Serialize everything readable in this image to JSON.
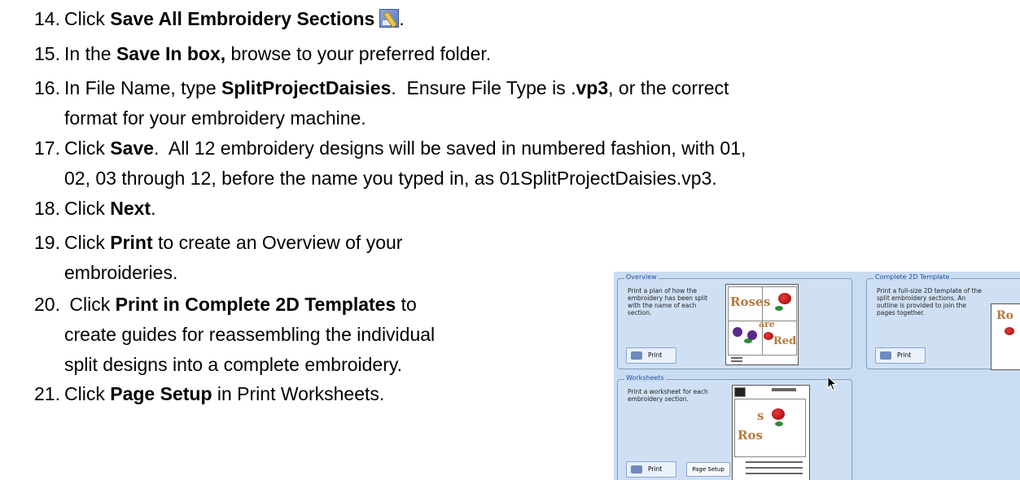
{
  "steps": [
    {
      "num": "14.",
      "parts": [
        {
          "t": "Click "
        },
        {
          "b": "Save All Embroidery Sections"
        }
      ],
      "icon": "save-all-icon",
      "after_icon": "."
    },
    {
      "num": "15.",
      "parts": [
        {
          "t": "In the "
        },
        {
          "b": "Save In box,"
        },
        {
          "t": " browse to your preferred folder."
        }
      ]
    },
    {
      "num": "16.",
      "parts": [
        {
          "t": "In File Name, type "
        },
        {
          "b": "SplitProjectDaisies"
        },
        {
          "t": ".  Ensure File Type is ."
        },
        {
          "b": "vp3"
        },
        {
          "t": ", or the correct"
        }
      ],
      "line2": "format for your embroidery machine."
    },
    {
      "num": "17.",
      "parts": [
        {
          "t": "Click "
        },
        {
          "b": "Save"
        },
        {
          "t": ".  All 12 embroidery designs will be saved in numbered fashion, with 01,"
        }
      ],
      "line2": "02, 03 through 12, before the name you typed in, as 01SplitProjectDaisies.vp3."
    },
    {
      "num": "18.",
      "parts": [
        {
          "t": "Click "
        },
        {
          "b": "Next"
        },
        {
          "t": "."
        }
      ]
    },
    {
      "num": "19.",
      "parts": [
        {
          "t": "Click "
        },
        {
          "b": "Print"
        },
        {
          "t": " to create an Overview of your"
        }
      ],
      "line2": "embroideries."
    },
    {
      "num": "20.",
      "parts": [
        {
          "t": " Click "
        },
        {
          "b": "Print in Complete 2D Templates"
        },
        {
          "t": " to"
        }
      ],
      "line2": "create guides for reassembling the individual",
      "line3": "split designs into a complete embroidery."
    },
    {
      "num": "21.",
      "parts": [
        {
          "t": "Click "
        },
        {
          "b": "Page Setup"
        },
        {
          "t": " in Print Worksheets."
        }
      ]
    }
  ],
  "dialog": {
    "overview": {
      "title": "Overview",
      "text": "Print a plan of how the embroidery has been split with the name of each section.",
      "print": "Print"
    },
    "complete2d": {
      "title": "Complete 2D Template",
      "text": "Print a full-size 2D template of the split embroidery sections. An outline is provided to join the pages together.",
      "print": "Print"
    },
    "worksheets": {
      "title": "Worksheets",
      "text": "Print a worksheet for each embroidery section.",
      "print": "Print",
      "page_setup": "Page Setup"
    },
    "thumb_overview": {
      "w1": "Rose",
      "w2": "s",
      "w3": "are",
      "w4": "Red"
    },
    "thumb_worksheet": {
      "w1": "Ros",
      "w2": "s"
    },
    "thumb_complete": {
      "w1": "Ro"
    }
  }
}
